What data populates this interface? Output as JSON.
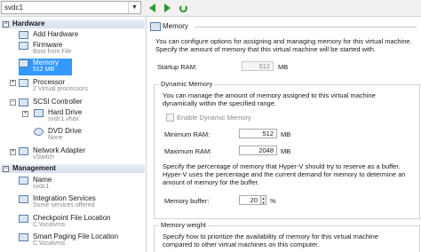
{
  "toolbar": {
    "vm_name": "svdc1"
  },
  "tree": {
    "hardware_label": "Hardware",
    "management_label": "Management",
    "items": [
      {
        "label": "Add Hardware",
        "sub": ""
      },
      {
        "label": "Firmware",
        "sub": "Boot from File"
      },
      {
        "label": "Memory",
        "sub": "512 MB"
      },
      {
        "label": "Processor",
        "sub": "2 Virtual processors"
      },
      {
        "label": "SCSI Controller",
        "sub": ""
      },
      {
        "label": "Hard Drive",
        "sub": "svdc1.vhdx"
      },
      {
        "label": "DVD Drive",
        "sub": "None"
      },
      {
        "label": "Network Adapter",
        "sub": "vSwitch"
      },
      {
        "label": "Name",
        "sub": "svdc1"
      },
      {
        "label": "Integration Services",
        "sub": "Some services offered"
      },
      {
        "label": "Checkpoint File Location",
        "sub": "C:\\localvms"
      },
      {
        "label": "Smart Paging File Location",
        "sub": "C:\\localvms"
      }
    ]
  },
  "memory": {
    "header": "Memory",
    "intro1": "You can configure options for assigning and managing memory for this virtual machine.",
    "intro2": "Specify the amount of memory that this virtual machine will be started with.",
    "startup_label": "Startup RAM:",
    "startup_value": "512",
    "unit": "MB",
    "dynamic_title": "Dynamic Memory",
    "dynamic_text1": "You can manage the amount of memory assigned to this virtual machine",
    "dynamic_text2": "dynamically within the specified range.",
    "enable_label": "Enable Dynamic Memory",
    "min_label": "Minimum RAM:",
    "min_value": "512",
    "max_label": "Maximum RAM:",
    "max_value": "2048",
    "buffer_text1": "Specify the percentage of memory that Hyper-V should try to reserve as a buffer.",
    "buffer_text2": "Hyper-V uses the percentage and the current demand for memory to determine an",
    "buffer_text3": "amount of memory for the buffer.",
    "buffer_label": "Memory buffer:",
    "buffer_value": "20",
    "percent": "%",
    "weight_title": "Memory weight",
    "weight_text1": "Specify how to prioritize the availability of memory for this virtual machine",
    "weight_text2": "compared to other virtual machines on this computer."
  }
}
